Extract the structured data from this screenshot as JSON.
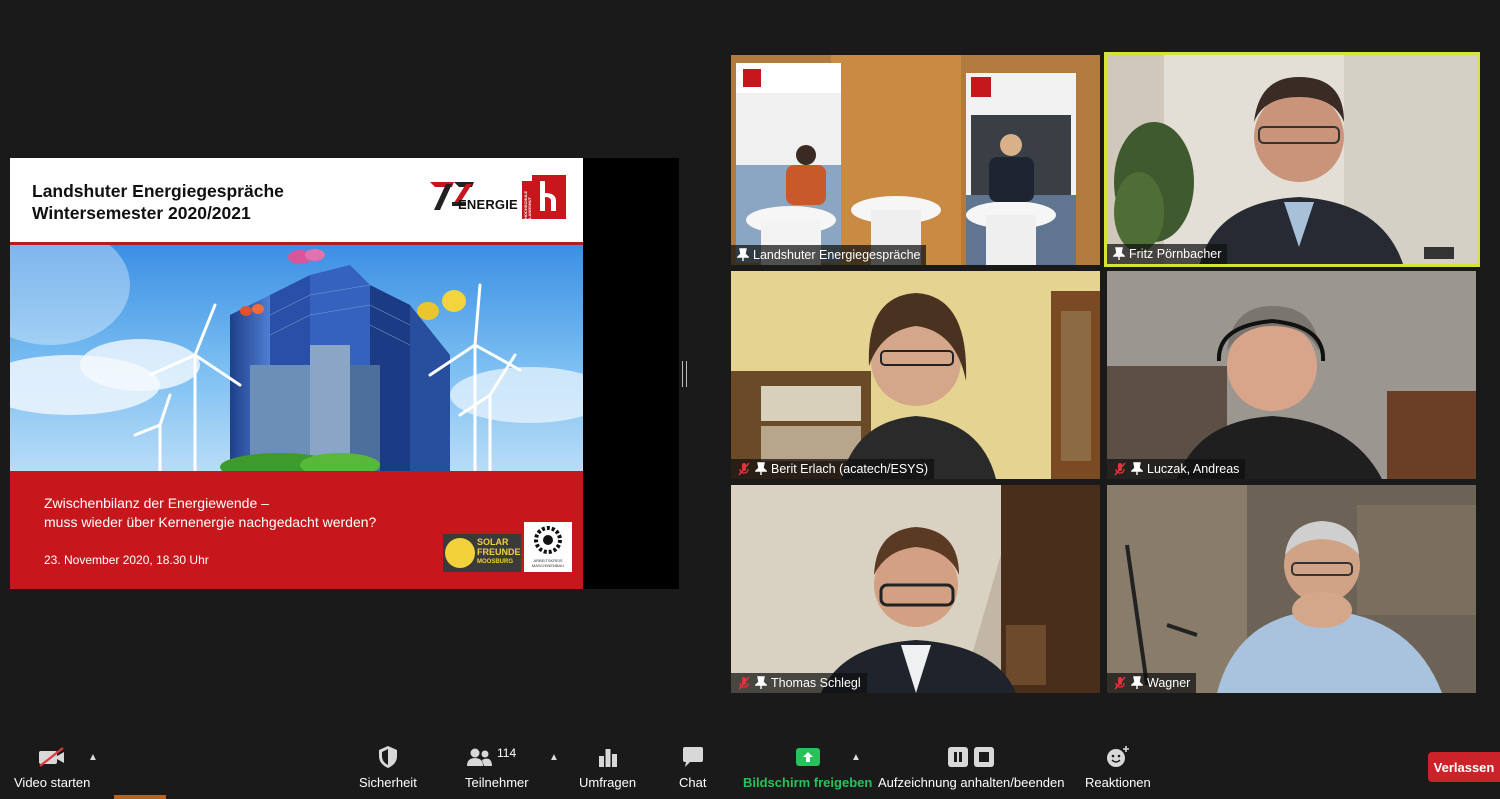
{
  "slide": {
    "title_line1": "Landshuter Energiegespräche",
    "title_line2": "Wintersemester 2020/2021",
    "logo_energie_text": "ENERGIE",
    "logo_hl_text": "HOCHSCHULE LANDSHUT",
    "footer_line1": "Zwischenbilanz der Energiewende –",
    "footer_line2": "muss wieder über Kernenergie nachgedacht werden?",
    "footer_date": "23. November 2020, 18.30 Uhr",
    "solar_logo_line1": "SOLAR",
    "solar_logo_line2": "FREUNDE",
    "solar_logo_line3": "MOOSBURG",
    "machine_logo_text": "ARBEITSKREIS MASCHINENBAU"
  },
  "participants": [
    {
      "name": "Landshuter Energiegespräche",
      "muted": false
    },
    {
      "name": "Fritz Pörnbacher",
      "muted": false,
      "active_speaker": true
    },
    {
      "name": "Berit Erlach (acatech/ESYS)",
      "muted": true
    },
    {
      "name": "Luczak, Andreas",
      "muted": true
    },
    {
      "name": "Thomas Schlegl",
      "muted": true
    },
    {
      "name": "Wagner",
      "muted": true
    }
  ],
  "toolbar": {
    "video_label": "Video starten",
    "security_label": "Sicherheit",
    "participants_label": "Teilnehmer",
    "participants_count": "114",
    "polls_label": "Umfragen",
    "chat_label": "Chat",
    "share_label": "Bildschirm freigeben",
    "record_label": "Aufzeichnung anhalten/beenden",
    "reactions_label": "Reaktionen",
    "leave_label": "Verlassen"
  },
  "colors": {
    "active_speaker_border": "#d6e33a",
    "share_green": "#27c35a",
    "leave_red": "#cc2229",
    "slide_red": "#c8161d"
  }
}
